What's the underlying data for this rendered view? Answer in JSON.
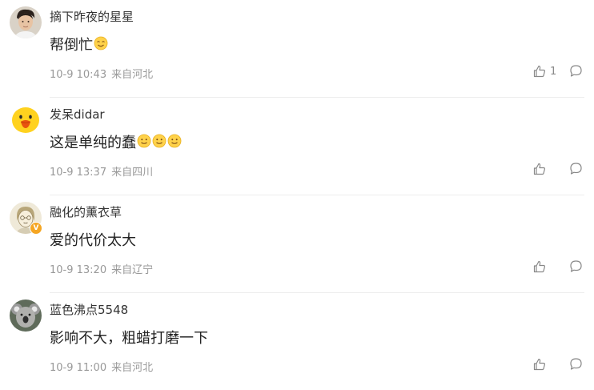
{
  "comments": [
    {
      "username": "摘下昨夜的星星",
      "text": "帮倒忙",
      "emoji_count": 1,
      "time": "10-9 10:43",
      "location": "来自河北",
      "likes": "1",
      "avatar": "photo-man-avatar",
      "verified": false
    },
    {
      "username": "发呆didar",
      "text": "这是单纯的蠢",
      "emoji_count": 3,
      "time": "10-9 13:37",
      "location": "来自四川",
      "likes": "",
      "avatar": "yellow-chick-avatar",
      "verified": false
    },
    {
      "username": "融化的薰衣草",
      "text": "爱的代价太大",
      "emoji_count": 0,
      "time": "10-9 13:20",
      "location": "来自辽宁",
      "likes": "",
      "avatar": "sketch-face-avatar",
      "verified": true,
      "verified_mark": "V"
    },
    {
      "username": "蓝色沸点5548",
      "text": "影响不大，粗蜡打磨一下",
      "emoji_count": 0,
      "time": "10-9 11:00",
      "location": "来自河北",
      "likes": "",
      "avatar": "koala-avatar",
      "verified": false
    }
  ],
  "colors": {
    "username": "#333333",
    "content": "#222222",
    "meta": "#999999",
    "icon": "#888888",
    "divider": "#ececec",
    "verified_badge": "#f5a623"
  },
  "icons": {
    "like": "thumbs-up-icon",
    "reply": "speech-bubble-icon",
    "emoji": "smile-emoji-icon"
  }
}
